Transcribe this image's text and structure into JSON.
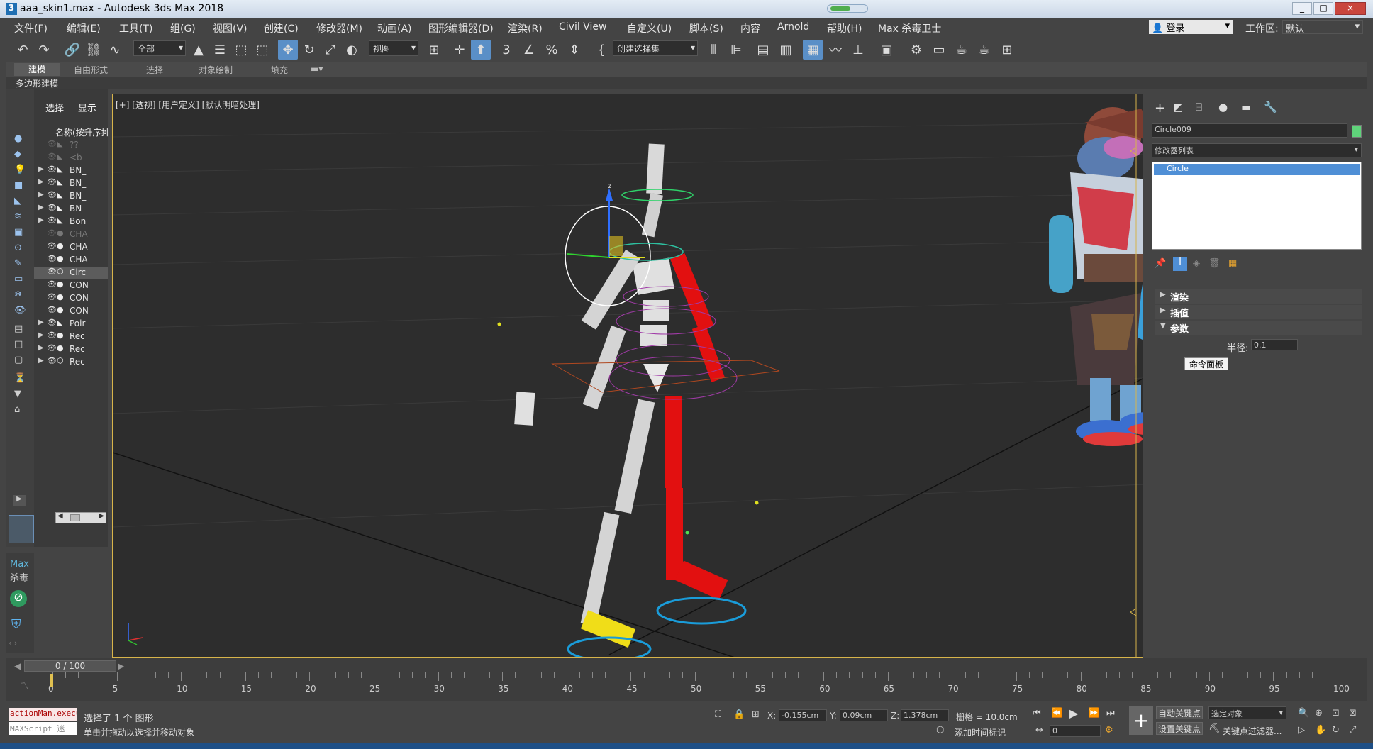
{
  "window": {
    "title": "aaa_skin1.max - Autodesk 3ds Max 2018",
    "controls": [
      "_",
      "□",
      "×"
    ]
  },
  "menu": [
    "文件(F)",
    "编辑(E)",
    "工具(T)",
    "组(G)",
    "视图(V)",
    "创建(C)",
    "修改器(M)",
    "动画(A)",
    "图形编辑器(D)",
    "渲染(R)",
    "Civil View",
    "自定义(U)",
    "脚本(S)",
    "内容",
    "Arnold",
    "帮助(H)",
    "Max 杀毒卫士"
  ],
  "account": {
    "user": "登录",
    "workspace_label": "工作区:",
    "workspace_value": "默认"
  },
  "toolbar": {
    "selection_filter": "全部",
    "ref_coord": "视图",
    "named_selection": "创建选择集"
  },
  "ribbon": {
    "tabs": [
      "建模",
      "自由形式",
      "选择",
      "对象绘制",
      "填充"
    ],
    "active_tab": "建模",
    "subpanel": "多边形建模"
  },
  "scene_explorer": {
    "tabs": [
      "选择",
      "显示"
    ],
    "header": "名称(按升序排",
    "rows": [
      {
        "label": "??",
        "icon": "bone-icon",
        "expand": false,
        "dim": true
      },
      {
        "label": "<b",
        "icon": "bone-icon",
        "expand": false,
        "dim": true
      },
      {
        "label": "BN_",
        "icon": "bone-icon",
        "expand": true,
        "dim": false
      },
      {
        "label": "BN_",
        "icon": "bone-icon",
        "expand": true,
        "dim": false
      },
      {
        "label": "BN_",
        "icon": "bone-icon",
        "expand": true,
        "dim": false
      },
      {
        "label": "BN_",
        "icon": "bone-icon",
        "expand": true,
        "dim": false
      },
      {
        "label": "Bon",
        "icon": "bone-icon",
        "expand": true,
        "dim": false
      },
      {
        "label": "CHA",
        "icon": "sphere-icon",
        "expand": false,
        "dim": true
      },
      {
        "label": "CHA",
        "icon": "sphere-icon",
        "expand": false,
        "dim": false
      },
      {
        "label": "CHA",
        "icon": "sphere-icon",
        "expand": false,
        "dim": false
      },
      {
        "label": "Circ",
        "icon": "shape-icon",
        "expand": false,
        "dim": false,
        "selected": true
      },
      {
        "label": "CON",
        "icon": "sphere-icon",
        "expand": false,
        "dim": false
      },
      {
        "label": "CON",
        "icon": "sphere-icon",
        "expand": false,
        "dim": false
      },
      {
        "label": "CON",
        "icon": "sphere-icon",
        "expand": false,
        "dim": false
      },
      {
        "label": "Poir",
        "icon": "bone-icon",
        "expand": true,
        "dim": false
      },
      {
        "label": "Rec",
        "icon": "sphere-icon",
        "expand": true,
        "dim": false
      },
      {
        "label": "Rec",
        "icon": "sphere-icon",
        "expand": true,
        "dim": false
      },
      {
        "label": "Rec",
        "icon": "shape-icon",
        "expand": true,
        "dim": false
      }
    ]
  },
  "viewport": {
    "label": "[+] [透视] [用户定义] [默认明暗处理]",
    "axis_labels": [
      "x",
      "y",
      "z"
    ]
  },
  "command_panel": {
    "object_name": "Circle009",
    "object_color": "#5fd37a",
    "modifier_list": "修改器列表",
    "stack": [
      "Circle"
    ],
    "rollouts": [
      {
        "label": "渲染",
        "open": false
      },
      {
        "label": "插值",
        "open": false
      },
      {
        "label": "参数",
        "open": true
      }
    ],
    "radius_label": "半径:",
    "radius_value": "0.1",
    "tooltip": "命令面板"
  },
  "sidebar_brand": {
    "line1": "Max",
    "line2": "杀毒"
  },
  "timeline": {
    "frame_display": "0 / 100",
    "ticks": [
      "0",
      "5",
      "10",
      "15",
      "20",
      "25",
      "30",
      "35",
      "40",
      "45",
      "50",
      "55",
      "60",
      "65",
      "70",
      "75",
      "80",
      "85",
      "90",
      "95",
      "100"
    ]
  },
  "status": {
    "script_listener_1": "actionMan.execu",
    "script_listener_2": "MAXScript 迷",
    "selection_info": "选择了 1 个 图形",
    "prompt": "单击并拖动以选择并移动对象",
    "x_label": "X:",
    "x_value": "-0.155cm",
    "y_label": "Y:",
    "y_value": "0.09cm",
    "z_label": "Z:",
    "z_value": "1.378cm",
    "grid": "栅格 = 10.0cm",
    "add_time_tag": "添加时间标记",
    "frame_field": "0",
    "auto_key": "自动关键点",
    "set_key": "设置关键点",
    "selected_object": "选定对象",
    "key_filters": "关键点过滤器..."
  }
}
